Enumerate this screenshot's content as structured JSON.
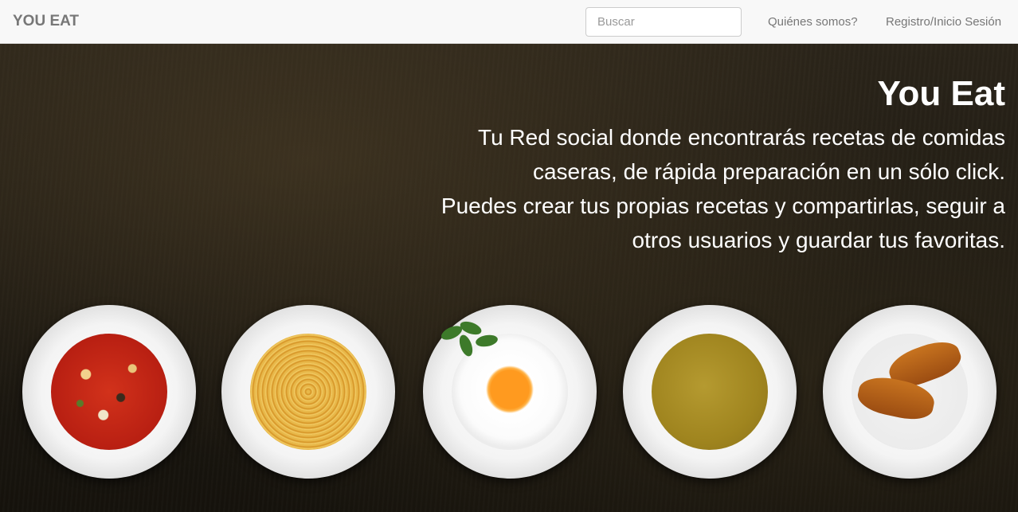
{
  "navbar": {
    "brand": "YOU EAT",
    "search_placeholder": "Buscar",
    "links": [
      "Quiénes somos?",
      "Registro/Inicio Sesión"
    ]
  },
  "hero": {
    "title": "You Eat",
    "paragraph1": "Tu Red social donde encontrarás recetas de comidas caseras, de rápida preparación en un sólo click.",
    "paragraph2": "Puedes crear tus propias recetas y compartirlas, seguir a otros usuarios y guardar tus favoritas."
  },
  "colors": {
    "navbar_bg": "#f8f8f8",
    "brand": "#777777",
    "hero_bg": "#1c1811",
    "hero_text": "#ffffff"
  }
}
